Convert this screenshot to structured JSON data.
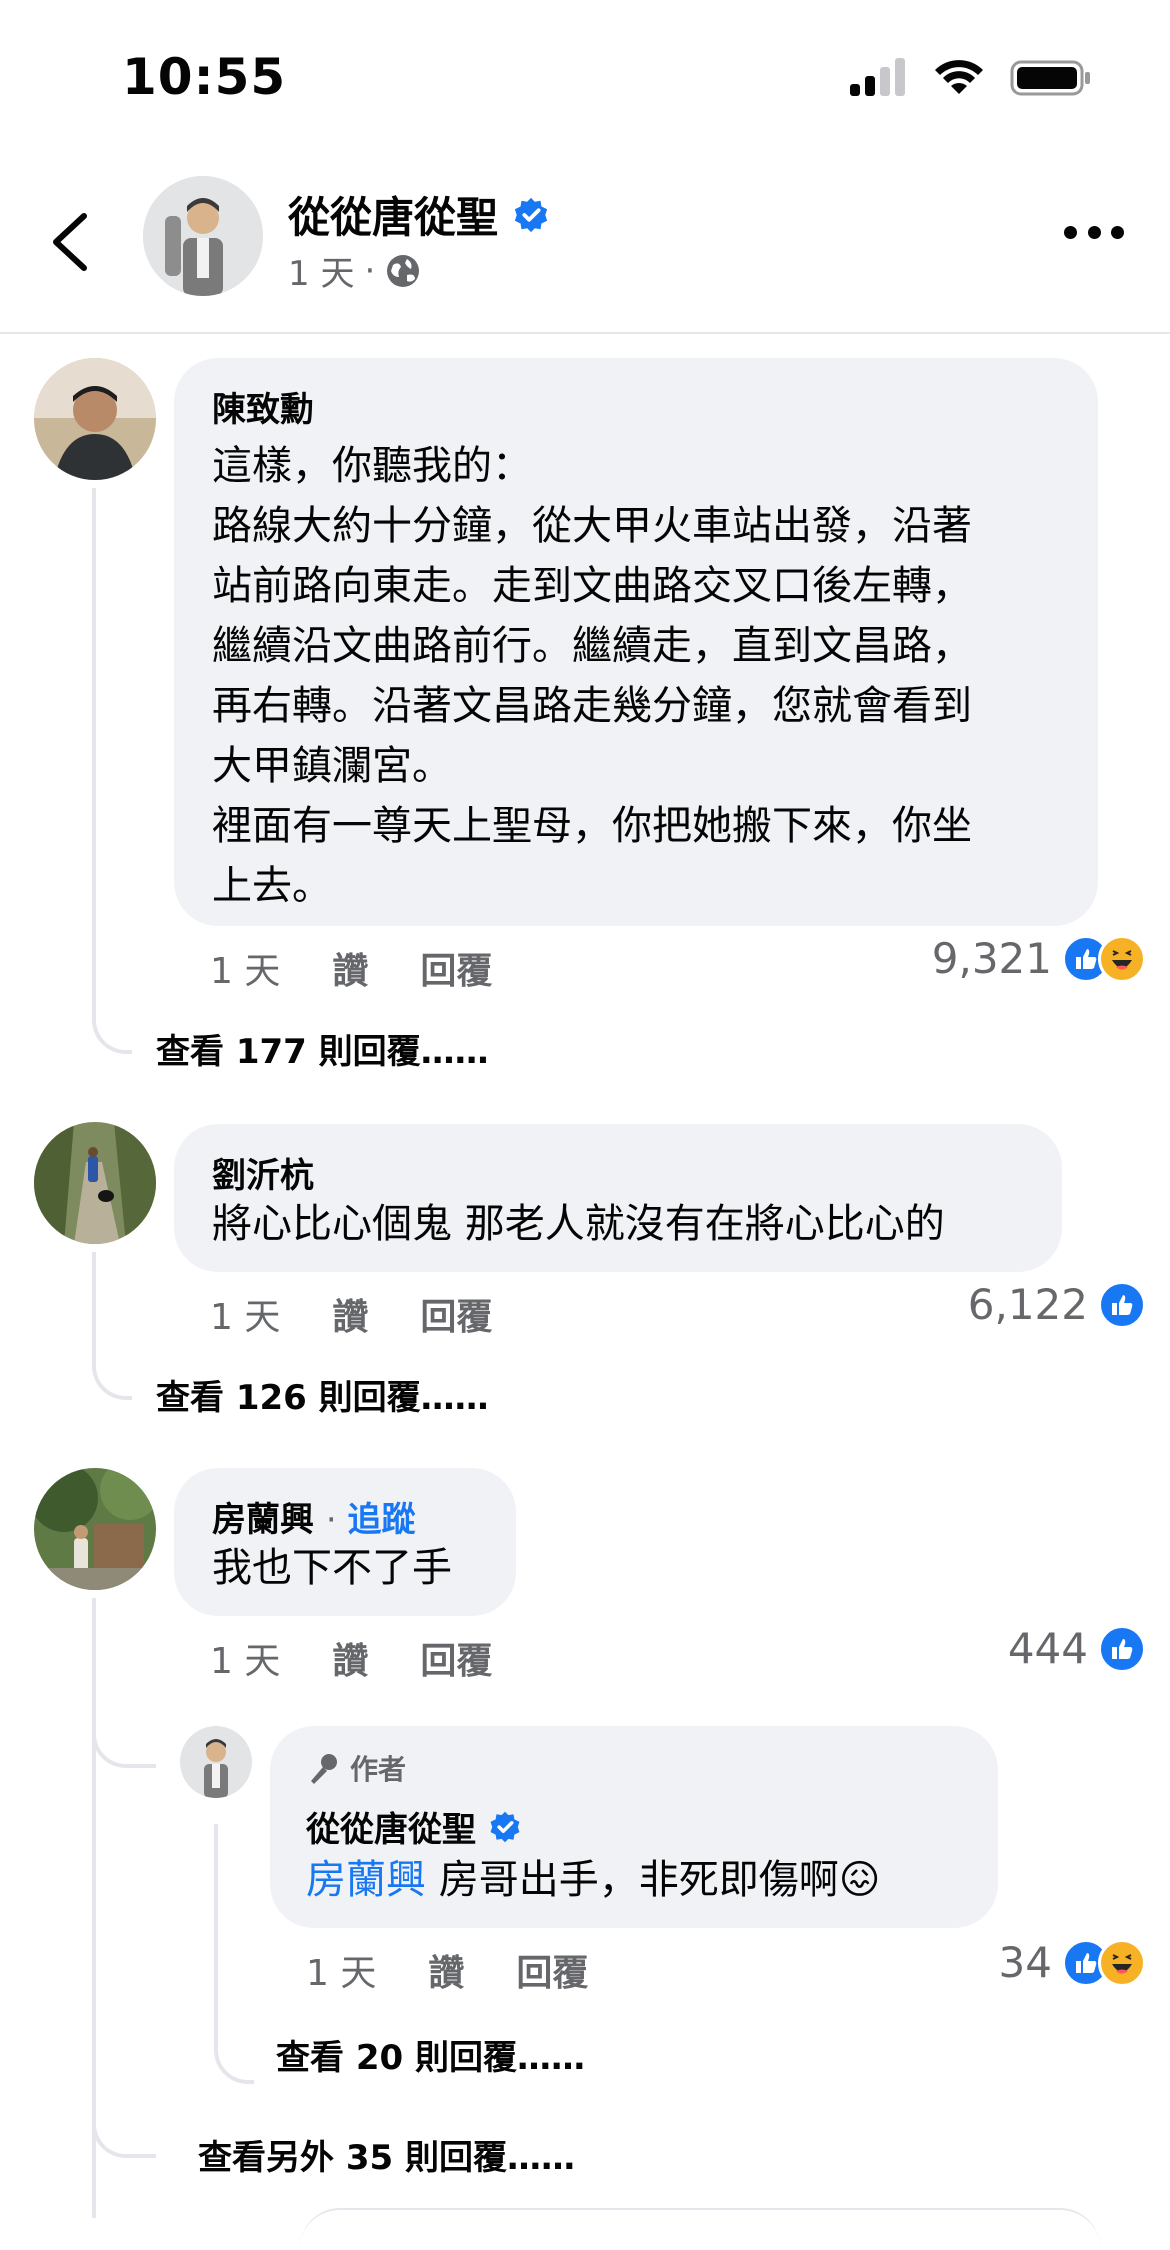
{
  "status_bar": {
    "time": "10:55"
  },
  "post": {
    "author": "從從唐從聖",
    "verified": true,
    "time": "1 天",
    "audience_icon": "globe-icon"
  },
  "actions": {
    "like": "讚",
    "reply": "回覆"
  },
  "comments": [
    {
      "name": "陳致勳",
      "lines": [
        "這樣，你聽我的：",
        "路線大約十分鐘，從大甲火車站出發，沿著",
        "站前路向東走。走到文曲路交叉口後左轉，",
        "繼續沿文曲路前行。繼續走，直到文昌路，",
        "再右轉。沿著文昌路走幾分鐘，您就會看到",
        "大甲鎮瀾宮。",
        "裡面有一尊天上聖母，你把她搬下來，你坐",
        "上去。"
      ],
      "time": "1 天",
      "reaction_count": "9,321",
      "reactions": [
        "like",
        "haha"
      ],
      "view_replies": "查看 177 則回覆……"
    },
    {
      "name": "劉沂杭",
      "lines": [
        "將心比心個鬼 那老人就沒有在將心比心的"
      ],
      "time": "1 天",
      "reaction_count": "6,122",
      "reactions": [
        "like"
      ],
      "view_replies": "查看 126 則回覆……"
    },
    {
      "name": "房蘭興",
      "follow": "追蹤",
      "lines": [
        "我也下不了手"
      ],
      "time": "1 天",
      "reaction_count": "444",
      "reactions": [
        "like"
      ],
      "reply": {
        "badge": "作者",
        "name": "從從唐從聖",
        "mention": "房蘭興",
        "text": " 房哥出手，非死即傷啊",
        "emoji": "😖",
        "time": "1 天",
        "reaction_count": "34",
        "reactions": [
          "like",
          "haha"
        ],
        "view_replies": "查看 20 則回覆……"
      },
      "view_more": "查看另外 35 則回覆……"
    }
  ],
  "colors": {
    "accent": "#1877f2",
    "bubble": "#f0f2f5",
    "meta": "#65676b",
    "haha": "#f7b125"
  }
}
